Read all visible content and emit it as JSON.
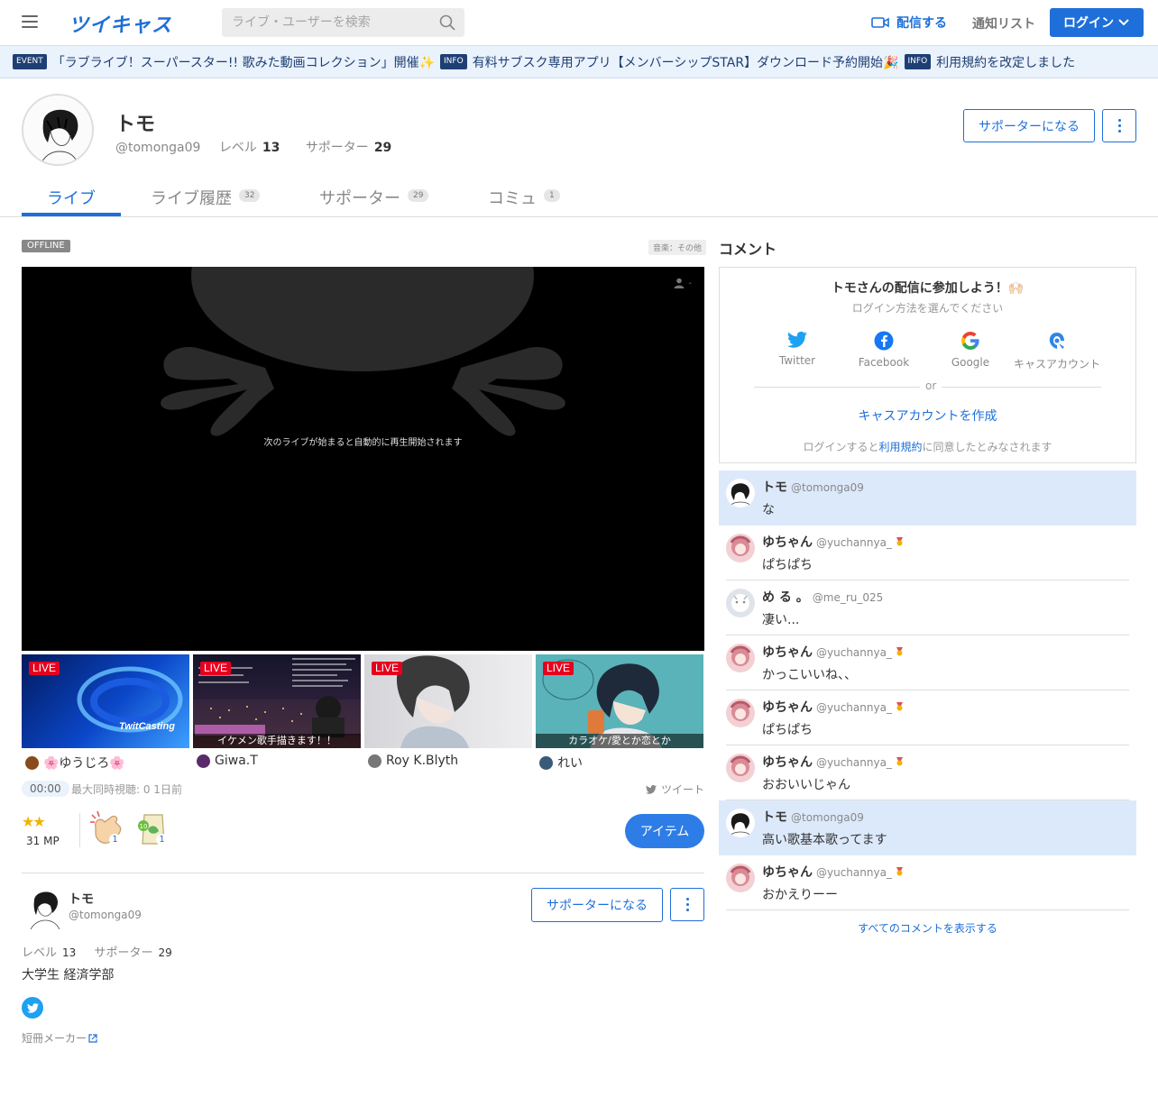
{
  "header": {
    "logo": "ツイキャス",
    "search_placeholder": "ライブ・ユーザーを検索",
    "broadcast_label": "配信する",
    "notify_label": "通知リスト",
    "login_label": "ログイン"
  },
  "ticker": [
    {
      "badge": "EVENT",
      "text": "「ラブライブ！スーパースター!! 歌みた動画コレクション」開催✨"
    },
    {
      "badge": "INFO",
      "text": "有料サブスク専用アプリ【メンバーシップSTAR】ダウンロード予約開始🎉"
    },
    {
      "badge": "INFO",
      "text": "利用規約を改定しました"
    }
  ],
  "profile": {
    "name": "トモ",
    "handle": "@tomonga09",
    "level_label": "レベル",
    "level": "13",
    "supporters_label": "サポーター",
    "supporters": "29",
    "supporter_button": "サポーターになる"
  },
  "tabs": [
    {
      "label": "ライブ",
      "count": "",
      "active": true
    },
    {
      "label": "ライブ履歴",
      "count": "32"
    },
    {
      "label": "サポーター",
      "count": "29"
    },
    {
      "label": "コミュ",
      "count": "1"
    }
  ],
  "player": {
    "status": "OFFLINE",
    "category": "音楽：その他",
    "message": "次のライブが始まると自動的に再生開始されます",
    "viewers": "-"
  },
  "thumbnails": [
    {
      "live": "LIVE",
      "caption": "",
      "overlay": "TwitCasting",
      "user": "🌸ゆうじろ🌸",
      "bg": "#0a3a9c"
    },
    {
      "live": "LIVE",
      "caption": "イケメン歌手描きます！！",
      "overlay": "",
      "user": "Giwa.T",
      "bg": "#1a1a2e"
    },
    {
      "live": "LIVE",
      "caption": "",
      "overlay": "",
      "user": "Roy K.Blyth",
      "bg": "#c8c8cc"
    },
    {
      "live": "LIVE",
      "caption": "カラオケ/愛とか恋とか",
      "overlay": "",
      "user": "れい",
      "bg": "#5fb8bd"
    }
  ],
  "stats": {
    "time": "00:00",
    "text": "最大同時視聴: 0  1日前",
    "tweet": "ツイート"
  },
  "mp": {
    "value": "31 MP",
    "items": [
      {
        "name": "clap",
        "count": "1"
      },
      {
        "name": "tea",
        "count": "1"
      }
    ],
    "item_button": "アイテム"
  },
  "bottom_profile": {
    "name": "トモ",
    "handle": "@tomonga09",
    "supporter_button": "サポーターになる",
    "level_label": "レベル",
    "level": "13",
    "supporters_label": "サポーター",
    "supporters": "29",
    "bio": "大学生 経済学部",
    "tanzaku": "短冊メーカー"
  },
  "comments_panel": {
    "heading": "コメント",
    "login_title": "トモさんの配信に参加しよう！🙌🏻",
    "login_sub": "ログイン方法を選んでください",
    "sns": [
      {
        "label": "Twitter",
        "color": "#1da1f2"
      },
      {
        "label": "Facebook",
        "color": "#1877f2"
      },
      {
        "label": "Google",
        "color": "#4285f4"
      },
      {
        "label": "キャスアカウント",
        "color": "#2e86e6"
      }
    ],
    "or": "or",
    "create_account": "キャスアカウントを作成",
    "terms_prefix": "ログインすると",
    "terms_link": "利用規約",
    "terms_suffix": "に同意したとみなされます",
    "comments": [
      {
        "name": "トモ",
        "id": "@tomonga09",
        "text": "な",
        "highlight": true,
        "medal": false,
        "avatar": "tomo"
      },
      {
        "name": "ゆちゃん",
        "id": "@yuchannya_",
        "text": "ぱちぱち",
        "highlight": false,
        "medal": true,
        "avatar": "yu"
      },
      {
        "name": "め る 。",
        "id": "@me_ru_025",
        "text": "凄い...",
        "highlight": false,
        "medal": false,
        "avatar": "meru"
      },
      {
        "name": "ゆちゃん",
        "id": "@yuchannya_",
        "text": "かっこいいね、、",
        "highlight": false,
        "medal": true,
        "avatar": "yu"
      },
      {
        "name": "ゆちゃん",
        "id": "@yuchannya_",
        "text": "ぱちぱち",
        "highlight": false,
        "medal": true,
        "avatar": "yu"
      },
      {
        "name": "ゆちゃん",
        "id": "@yuchannya_",
        "text": "おおいいじゃん",
        "highlight": false,
        "medal": true,
        "avatar": "yu"
      },
      {
        "name": "トモ",
        "id": "@tomonga09",
        "text": "高い歌基本歌ってます",
        "highlight": true,
        "medal": false,
        "avatar": "tomo"
      },
      {
        "name": "ゆちゃん",
        "id": "@yuchannya_",
        "text": "おかえりーー",
        "highlight": false,
        "medal": true,
        "avatar": "yu"
      }
    ],
    "show_all": "すべてのコメントを表示する"
  },
  "colors": {
    "accent": "#1e6fd9",
    "live_red": "#e6001f",
    "highlight": "#dce9fb"
  }
}
